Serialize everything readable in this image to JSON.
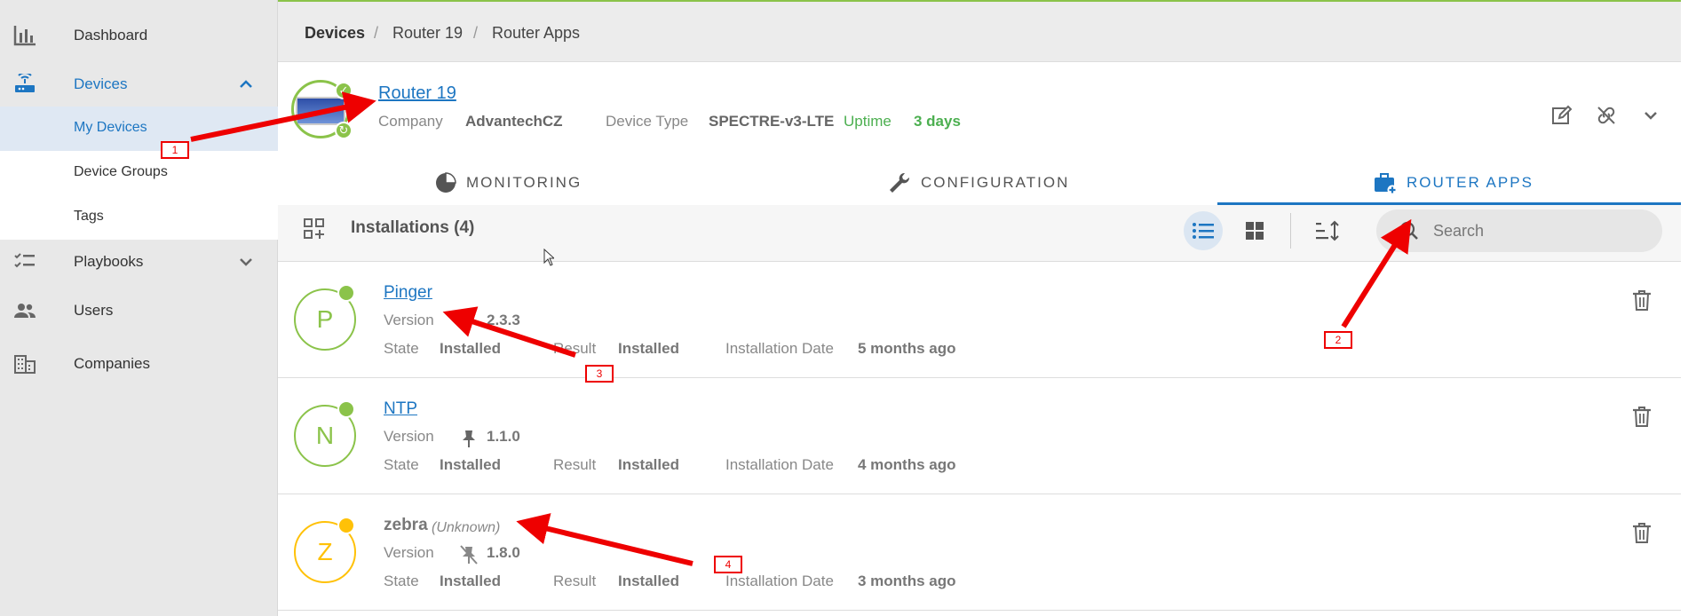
{
  "sidebar": {
    "items": [
      {
        "label": "Dashboard",
        "icon": "bar-chart-icon"
      },
      {
        "label": "Devices",
        "icon": "router-icon"
      },
      {
        "label": "Playbooks",
        "icon": "checklist-icon"
      },
      {
        "label": "Users",
        "icon": "users-icon"
      },
      {
        "label": "Companies",
        "icon": "building-icon"
      }
    ],
    "devices_sub": [
      "My Devices",
      "Device Groups",
      "Tags"
    ]
  },
  "breadcrumb": [
    "Devices",
    "Router 19",
    "Router Apps"
  ],
  "device": {
    "name": "Router 19",
    "company_label": "Company",
    "company": "AdvantechCZ",
    "type_label": "Device Type",
    "type": "SPECTRE-v3-LTE",
    "uptime_label": "Uptime",
    "uptime": "3 days"
  },
  "tabs": [
    "MONITORING",
    "CONFIGURATION",
    "ROUTER APPS"
  ],
  "toolbar": {
    "installations": "Installations (4)",
    "search_placeholder": "Search"
  },
  "labels": {
    "version": "Version",
    "state": "State",
    "result": "Result",
    "installation_date": "Installation Date"
  },
  "apps": [
    {
      "initial": "P",
      "name": "Pinger",
      "note": "",
      "version": "2.3.3",
      "state": "Installed",
      "result": "Installed",
      "date": "5 months ago",
      "status_color": "#8bc34a"
    },
    {
      "initial": "N",
      "name": "NTP",
      "note": "",
      "version": "1.1.0",
      "state": "Installed",
      "result": "Installed",
      "date": "4 months ago",
      "status_color": "#8bc34a"
    },
    {
      "initial": "Z",
      "name": "zebra",
      "note": "(Unknown)",
      "version": "1.8.0",
      "state": "Installed",
      "result": "Installed",
      "date": "3 months ago",
      "status_color": "#ffc107"
    }
  ],
  "annotations": [
    "1",
    "2",
    "3",
    "4"
  ],
  "colors": {
    "accent": "#1d76c2",
    "ok": "#8bc34a",
    "warn": "#ffc107",
    "arrow": "#e00000"
  }
}
